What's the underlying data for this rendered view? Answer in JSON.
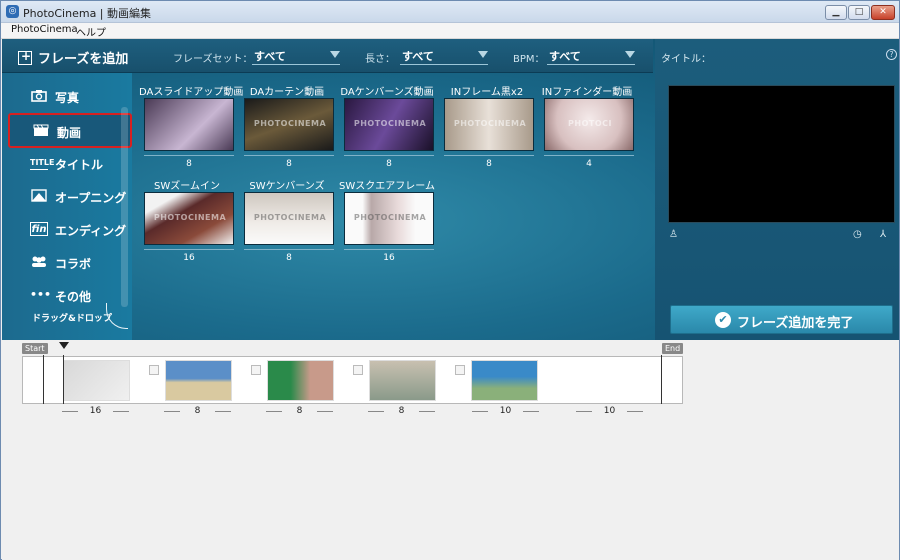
{
  "window": {
    "title": "PhotoCinema | 動画編集",
    "minimize": "▁",
    "maximize": "□",
    "close": "✕"
  },
  "menu": {
    "items": [
      "PhotoCinema",
      "ヘルプ"
    ]
  },
  "toolbar": {
    "add_phrase": "フレーズを追加",
    "phrase_set_label": "フレーズセット：",
    "phrase_set_value": "すべて",
    "length_label": "長さ：",
    "length_value": "すべて",
    "bpm_label": "BPM：",
    "bpm_value": "すべて"
  },
  "sidebar": {
    "items": [
      {
        "label": "写真",
        "icon": "camera-icon"
      },
      {
        "label": "動画",
        "icon": "clapper-icon"
      },
      {
        "label": "タイトル",
        "icon": "title-icon"
      },
      {
        "label": "オープニング",
        "icon": "opening-icon"
      },
      {
        "label": "エンディング",
        "icon": "fin-icon"
      },
      {
        "label": "コラボ",
        "icon": "people-icon"
      },
      {
        "label": "その他",
        "icon": "more-icon"
      }
    ],
    "selected": "動画",
    "drag_hint": "ドラッグ&ドロップ"
  },
  "phrases": [
    {
      "name": "DAスライドアップ動画",
      "count": "8",
      "watermark": "",
      "colors": [
        "#4a3a55",
        "#c8b6d2"
      ]
    },
    {
      "name": "DAカーテン動画",
      "count": "8",
      "watermark": "PHOTOCINEMA",
      "colors": [
        "#1a1a1a",
        "#6b5a3a"
      ]
    },
    {
      "name": "DAケンバーンズ動画",
      "count": "8",
      "watermark": "PHOTOCINEMA",
      "colors": [
        "#2a1840",
        "#6b4a9a"
      ]
    },
    {
      "name": "INフレーム黒x2",
      "count": "8",
      "watermark": "PHOTOCINEMA",
      "colors": [
        "#a89a8a",
        "#e8e0d8"
      ]
    },
    {
      "name": "INファインダー動画",
      "count": "4",
      "watermark": "PHOTOCI",
      "colors": [
        "#d8c0c0",
        "#f4eaea"
      ]
    },
    {
      "name": "SWズームイン",
      "count": "16",
      "watermark": "PHOTOCINEMA",
      "colors": [
        "#5a2a2a",
        "#f2f2f2"
      ]
    },
    {
      "name": "SWケンバーンズ",
      "count": "8",
      "watermark": "PHOTOCINEMA",
      "colors": [
        "#cfc8c0",
        "#f0ece8"
      ]
    },
    {
      "name": "SWスクエアフレーム",
      "count": "16",
      "watermark": "PHOTOCINEMA",
      "colors": [
        "#b8a8a8",
        "#fafafa"
      ]
    }
  ],
  "preview": {
    "title_label": "タイトル：",
    "help": "?",
    "finish_button": "フレーズ追加を完了"
  },
  "timeline": {
    "start_label": "Start",
    "end_label": "End",
    "clips": [
      {
        "duration": "16",
        "colors": [
          "#d8d8d8",
          "#f0f0f0"
        ]
      },
      {
        "duration": "8",
        "colors": [
          "#5b8fc8",
          "#d9c9a0"
        ]
      },
      {
        "duration": "8",
        "colors": [
          "#2a8a4a",
          "#c89a8a"
        ]
      },
      {
        "duration": "8",
        "colors": [
          "#8a9a8a",
          "#c8c0b0"
        ]
      },
      {
        "duration": "10",
        "colors": [
          "#3a8ac8",
          "#8ab07a"
        ]
      },
      {
        "duration": "10",
        "colors": [
          "#ffffff",
          "#ffffff"
        ]
      }
    ]
  }
}
